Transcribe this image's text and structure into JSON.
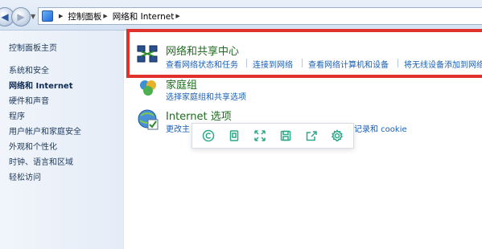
{
  "addressbar": {
    "breadcrumbs": [
      "控制面板",
      "网络和 Internet"
    ]
  },
  "sidebar": {
    "home": "控制面板主页",
    "items": [
      {
        "label": "系统和安全"
      },
      {
        "label": "网络和 Internet",
        "current": true
      },
      {
        "label": "硬件和声音"
      },
      {
        "label": "程序"
      },
      {
        "label": "用户帐户和家庭安全"
      },
      {
        "label": "外观和个性化"
      },
      {
        "label": "时钟、语言和区域"
      },
      {
        "label": "轻松访问"
      }
    ]
  },
  "categories": [
    {
      "title": "网络和共享中心",
      "icon": "network-sharing-icon",
      "links": [
        "查看网络状态和任务",
        "连接到网络",
        "查看网络计算机和设备",
        "将无线设备添加到网络"
      ]
    },
    {
      "title": "家庭组",
      "icon": "homegroup-icon",
      "links": [
        "选择家庭组和共享选项"
      ]
    },
    {
      "title": "Internet 选项",
      "icon": "internet-options-icon",
      "links": [
        "更改主",
        "记录和 cookie"
      ]
    }
  ],
  "toolbar": {
    "icons": [
      "copyright-icon",
      "page-icon",
      "expand-icon",
      "save-icon",
      "share-icon",
      "settings-icon"
    ]
  },
  "colors": {
    "highlight_border": "#e0312d",
    "category_title": "#1e6b1e",
    "link": "#1a5fb4",
    "toolbar_icon": "#2da889"
  }
}
